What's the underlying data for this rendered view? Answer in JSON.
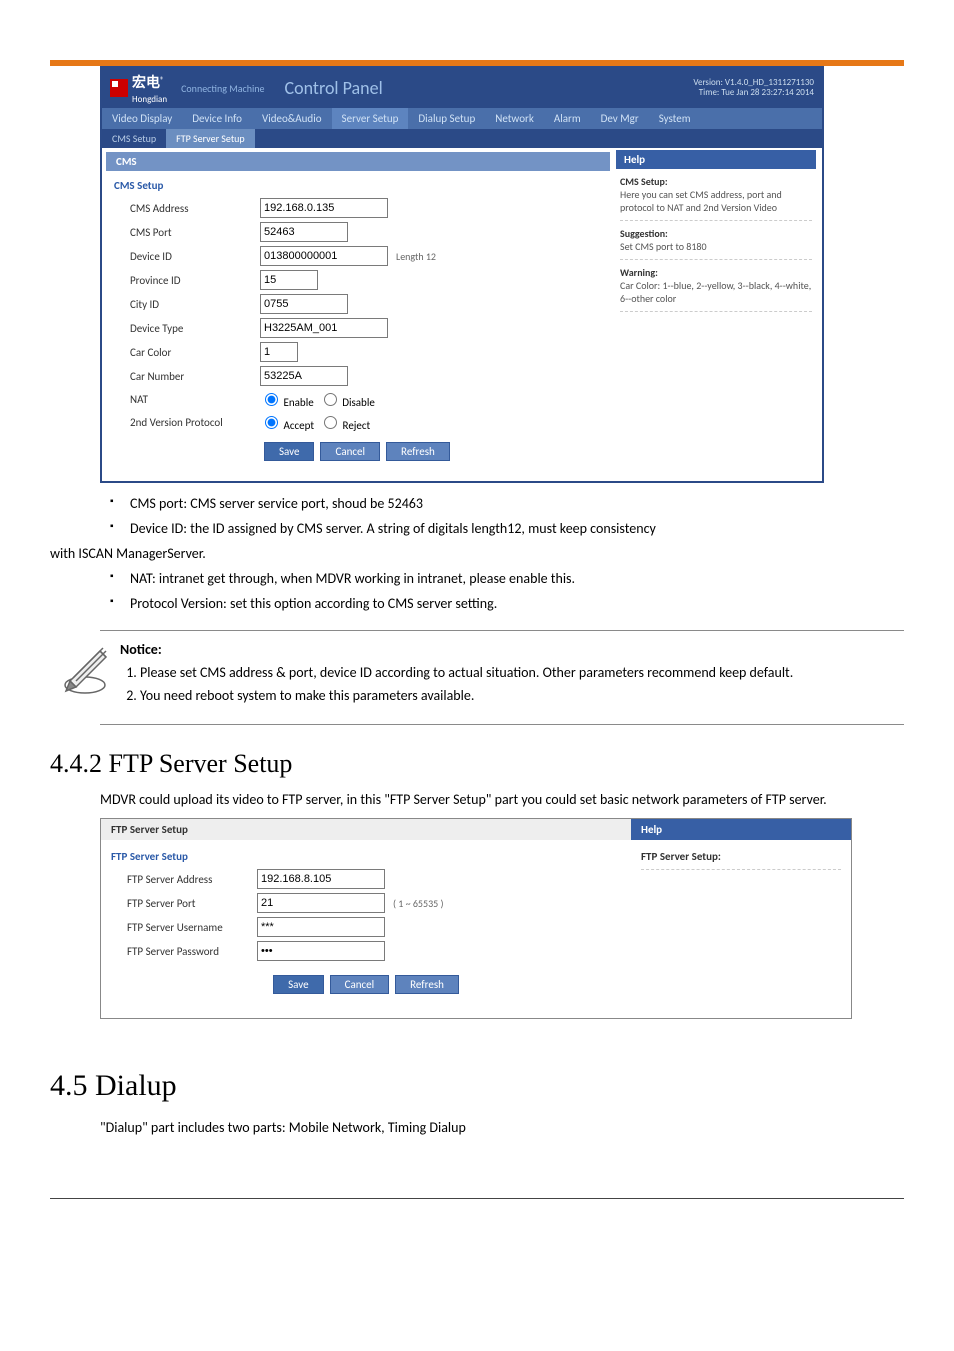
{
  "header": {
    "logo_text": "宏电",
    "logo_sub": "Hongdian",
    "connecting_machine": "Connecting Machine",
    "control_panel_title": "Control Panel",
    "version_line1": "Version: V1.4.0_HD_1311271130",
    "version_line2": "Time: Tue Jan 28 23:27:14 2014"
  },
  "tabs": [
    "Video Display",
    "Device Info",
    "Video&Audio",
    "Server Setup",
    "Dialup Setup",
    "Network",
    "Alarm",
    "Dev Mgr",
    "System"
  ],
  "sub_tabs": [
    "CMS Setup",
    "FTP Server Setup"
  ],
  "cms_bar": "CMS",
  "form": {
    "section_title": "CMS Setup",
    "rows": {
      "cms_address": {
        "label": "CMS Address",
        "value": "192.168.0.135"
      },
      "cms_port": {
        "label": "CMS Port",
        "value": "52463"
      },
      "device_id": {
        "label": "Device ID",
        "value": "013800000001",
        "after": "Length 12"
      },
      "province_id": {
        "label": "Province ID",
        "value": "15"
      },
      "city_id": {
        "label": "City ID",
        "value": "0755"
      },
      "device_type": {
        "label": "Device Type",
        "value": "H3225AM_001"
      },
      "car_color": {
        "label": "Car Color",
        "value": "1"
      },
      "car_number": {
        "label": "Car Number",
        "value": "53225A"
      },
      "nat": {
        "label": "NAT",
        "opt1": "Enable",
        "opt2": "Disable"
      },
      "protocol": {
        "label": "2nd Version Protocol",
        "opt1": "Accept",
        "opt2": "Reject"
      }
    }
  },
  "buttons": {
    "save": "Save",
    "cancel": "Cancel",
    "refresh": "Refresh"
  },
  "help": {
    "title": "Help",
    "cms_title": "CMS Setup:",
    "cms_text": "Here you can set CMS address, port and protocol to NAT and 2nd Version Video",
    "sugg_title": "Suggestion:",
    "sugg_text": "Set CMS port to 8180",
    "warn_title": "Warning:",
    "warn_text": "Car Color: 1--blue, 2--yellow, 3--black, 4--white, 6--other color"
  },
  "bullets": {
    "b1": "CMS port: CMS server service port, shoud be 52463",
    "b2": "Device ID: the ID assigned by CMS server. A string of digitals length12, must keep consistency",
    "b2_wrap": "with ISCAN ManagerServer.",
    "b3": "NAT: intranet get through, when MDVR working in intranet, please enable this.",
    "b4": "Protocol Version: set this option according to CMS server setting."
  },
  "notice": {
    "title": "Notice:",
    "n1": "Please set CMS address & port, device ID according to actual situation. Other parameters recommend keep default.",
    "n2": "You need reboot system to make this parameters available."
  },
  "section_442": {
    "heading": "4.4.2 FTP Server Setup",
    "body": "MDVR could upload its video to FTP server, in this \"FTP Server Setup\" part you could set basic network parameters of FTP server."
  },
  "ftp": {
    "title": "FTP Server Setup",
    "help_bar": "Help",
    "section_title": "FTP Server Setup",
    "help_title": "FTP Server Setup:",
    "rows": {
      "addr": {
        "label": "FTP Server Address",
        "value": "192.168.8.105"
      },
      "port": {
        "label": "FTP Server Port",
        "value": "21",
        "after": "( 1 ~ 65535 )"
      },
      "user": {
        "label": "FTP Server Username",
        "value": "***"
      },
      "pass": {
        "label": "FTP Server Password",
        "value": "•••"
      }
    }
  },
  "section_45": {
    "heading": "4.5 Dialup",
    "body": "\"Dialup\" part includes two parts: Mobile Network, Timing Dialup"
  }
}
